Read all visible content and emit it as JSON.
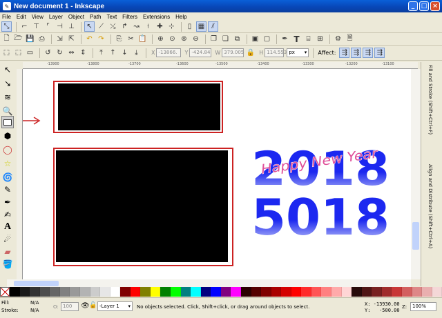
{
  "window": {
    "title": "New document 1 - Inkscape",
    "app_icon": "inkscape-icon"
  },
  "menu": [
    "File",
    "Edit",
    "View",
    "Layer",
    "Object",
    "Path",
    "Text",
    "Filters",
    "Extensions",
    "Help"
  ],
  "select_toolbar": {
    "x_label": "X",
    "x_value": "-13866.",
    "y_label": "Y",
    "y_value": "-424.84",
    "w_label": "W",
    "w_value": "379.005",
    "h_label": "H",
    "h_value": "114.553",
    "unit": "px",
    "affect_label": "Affect:"
  },
  "ruler": {
    "top_ticks": [
      "-13900",
      "-13800",
      "-13700",
      "-13600",
      "-13500",
      "-13400",
      "-13300",
      "-13200",
      "-13100"
    ]
  },
  "canvas": {
    "year_top": "2018",
    "year_bottom": "5018",
    "greeting": "Happy New Year",
    "colors": {
      "year": "#1c28f0",
      "greeting": "#e0509a",
      "highlight_box": "#cc2222",
      "arrow": "#cc2222"
    }
  },
  "dock": {
    "tab1": "Fill and Stroke (Shift+Ctrl+F)",
    "tab2": "Align and Distribute (Shift+Ctrl+A)"
  },
  "palette": [
    "#000000",
    "#1a1a1a",
    "#333333",
    "#4d4d4d",
    "#666666",
    "#808080",
    "#999999",
    "#b3b3b3",
    "#cccccc",
    "#e6e6e6",
    "#ffffff",
    "#800000",
    "#ff0000",
    "#808000",
    "#ffff00",
    "#008000",
    "#00ff00",
    "#008080",
    "#00ffff",
    "#000080",
    "#0000ff",
    "#800080",
    "#ff00ff",
    "#2b0000",
    "#550000",
    "#800000",
    "#aa0000",
    "#d40000",
    "#ff0000",
    "#ff2a2a",
    "#ff5555",
    "#ff8080",
    "#ffaaaa",
    "#ffd5d5",
    "#280b0b",
    "#501616",
    "#782121",
    "#a02c2c",
    "#c83737",
    "#d35f5f",
    "#de8787",
    "#e9afaf",
    "#f4d7d7"
  ],
  "status": {
    "fill_label": "Fill:",
    "fill_value": "N/A",
    "stroke_label": "Stroke:",
    "stroke_value": "N/A",
    "opacity_label": "O:",
    "opacity_value": "100",
    "layer": "-Layer 1",
    "message": "No objects selected. Click, Shift+click, or drag around objects to select.",
    "x_coord": "X: -13930.00",
    "y_coord": "Y:   -500.00",
    "zoom_label": "Z:",
    "zoom": "100%"
  }
}
